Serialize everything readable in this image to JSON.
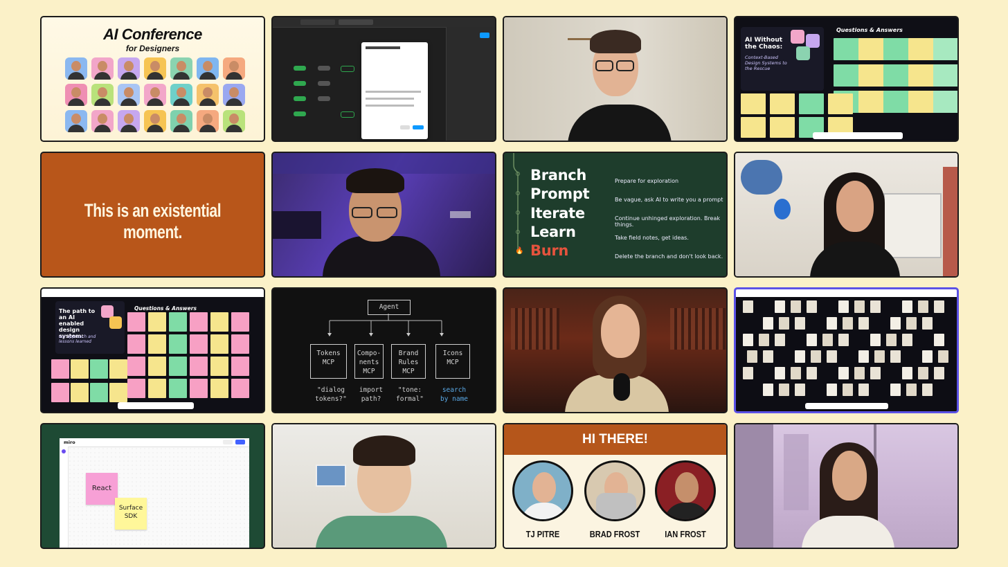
{
  "tile1": {
    "title": "AI Conference",
    "subtitle": "for Designers",
    "avatar_colors": [
      "#8bb8f0",
      "#f2a6c9",
      "#c6a7ef",
      "#f6c453",
      "#8bd3b0",
      "#7fb6f0",
      "#f5a97f",
      "#ef8fb3",
      "#b9e27b",
      "#a9c5f4",
      "#f2a6c9",
      "#6fd0c9",
      "#f5c26b",
      "#9aa8f0",
      "#8bb8f0",
      "#f2a6c9",
      "#c6a7ef",
      "#f6c453",
      "#7fd1ae",
      "#f5a97f",
      "#b9e27b"
    ]
  },
  "tile4": {
    "card_title": "AI Without the Chaos:",
    "card_sub": "Context-Based Design Systems to the Rescue",
    "qa_heading": "Questions & Answers"
  },
  "tile5": {
    "quote": "This is an existential moment."
  },
  "tile7": {
    "words": [
      "Branch",
      "Prompt",
      "Iterate",
      "Learn",
      "Burn"
    ],
    "steps": [
      "Prepare for exploration",
      "Be vague, ask AI to write you a prompt",
      "Continue unhinged exploration. Break things.",
      "Take field notes, get ideas.",
      "Delete the branch and don't look back."
    ],
    "accent": "#e5533d"
  },
  "tile9": {
    "card_title": "The path to an AI enabled design system:",
    "card_sub": "our approach and lessons learned",
    "qa_heading": "Questions & Answers"
  },
  "tile10": {
    "agent": "Agent",
    "boxes": [
      {
        "top": "Tokens",
        "bottom": "MCP"
      },
      {
        "top": "Compo-",
        "mid": "nents",
        "bottom": "MCP"
      },
      {
        "top": "Brand",
        "mid": "Rules",
        "bottom": "MCP"
      },
      {
        "top": "Icons",
        "bottom": "MCP"
      }
    ],
    "labels": [
      {
        "l1": "\"dialog",
        "l2": "tokens?\""
      },
      {
        "l1": "import",
        "l2": "path?"
      },
      {
        "l1": "\"tone:",
        "l2": "formal\""
      },
      {
        "l1": "search",
        "l2": "by name"
      }
    ]
  },
  "tile13": {
    "app_name": "miro",
    "sticky1": "React",
    "sticky2": "Surface SDK"
  },
  "tile15": {
    "banner": "HI THERE!",
    "names": [
      "TJ PITRE",
      "BRAD FROST",
      "IAN FROST"
    ]
  }
}
